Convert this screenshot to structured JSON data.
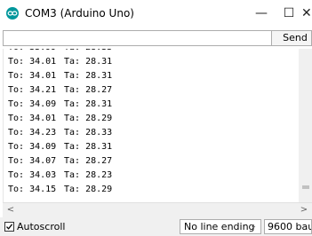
{
  "window": {
    "title": "COM3 (Arduino Uno)",
    "icon": "arduino-logo-icon",
    "controls": {
      "minimize": "—",
      "maximize": "☐",
      "close": "✕"
    }
  },
  "send_bar": {
    "input_value": "",
    "button_label": "Send"
  },
  "serial_output": {
    "lines": [
      {
        "to": "To: 33.99",
        "ta": "Ta: 28.33"
      },
      {
        "to": "To: 34.01",
        "ta": "Ta: 28.31"
      },
      {
        "to": "To: 34.01",
        "ta": "Ta: 28.31"
      },
      {
        "to": "To: 34.21",
        "ta": "Ta: 28.27"
      },
      {
        "to": "To: 34.09",
        "ta": "Ta: 28.31"
      },
      {
        "to": "To: 34.01",
        "ta": "Ta: 28.29"
      },
      {
        "to": "To: 34.23",
        "ta": "Ta: 28.33"
      },
      {
        "to": "To: 34.09",
        "ta": "Ta: 28.31"
      },
      {
        "to": "To: 34.07",
        "ta": "Ta: 28.27"
      },
      {
        "to": "To: 34.03",
        "ta": "Ta: 28.23"
      },
      {
        "to": "To: 34.15",
        "ta": "Ta: 28.29"
      }
    ]
  },
  "scrollbar": {
    "left_arrow": "<",
    "right_arrow": ">"
  },
  "status_bar": {
    "autoscroll_label": "Autoscroll",
    "autoscroll_checked": true,
    "line_ending": "No line ending",
    "baud_rate": "9600 baud"
  },
  "colors": {
    "arduino_teal": "#00979c"
  }
}
